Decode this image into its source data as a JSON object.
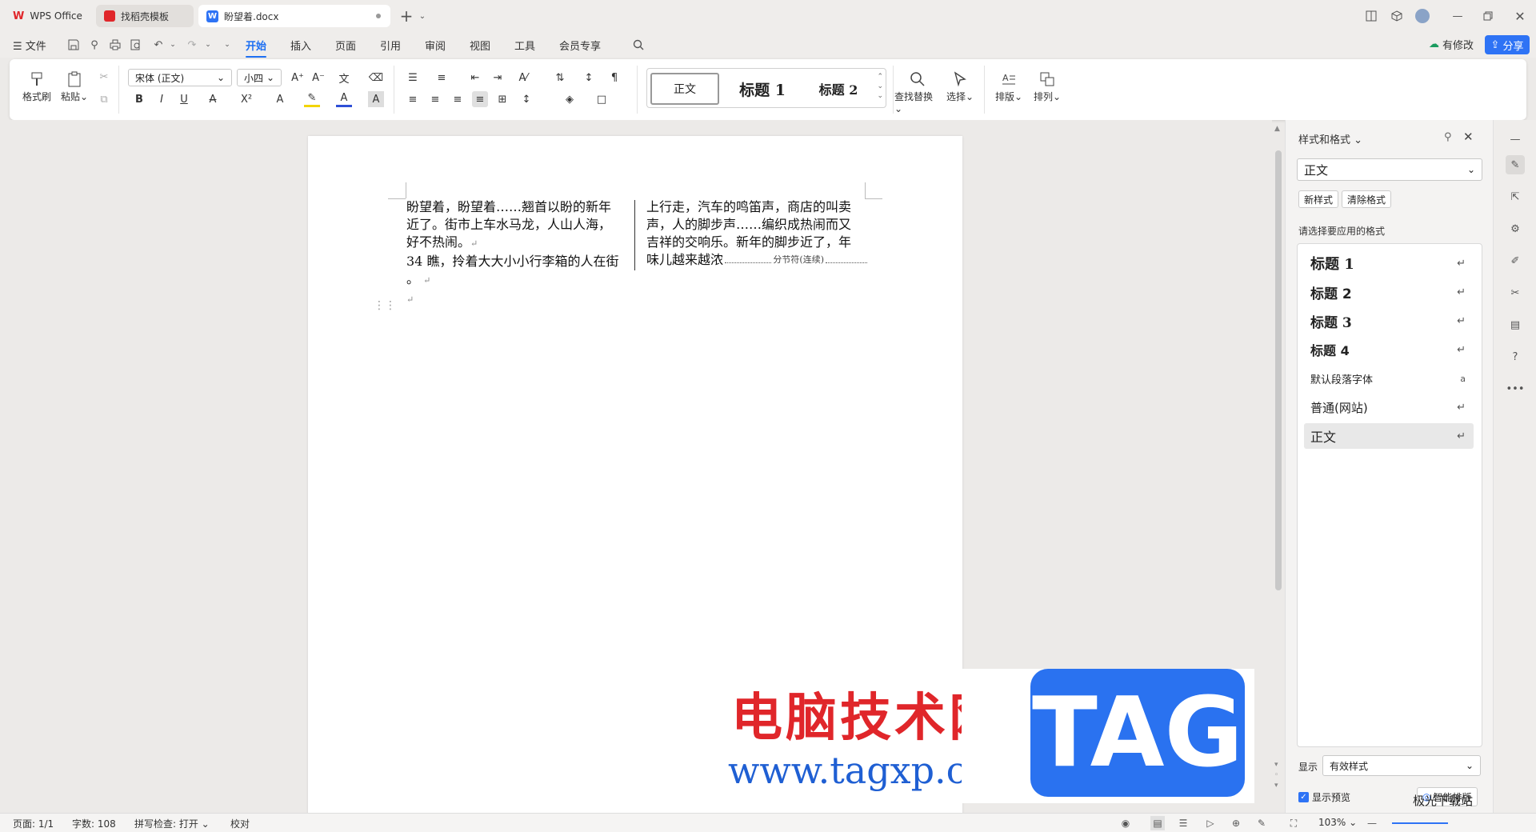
{
  "titlebar": {
    "tabs": [
      {
        "label": "WPS Office"
      },
      {
        "label": "找稻壳模板"
      },
      {
        "label": "盼望着.docx"
      }
    ],
    "new_tab": "+"
  },
  "menu": {
    "file": "文件",
    "items": [
      "开始",
      "插入",
      "页面",
      "引用",
      "审阅",
      "视图",
      "工具",
      "会员专享"
    ],
    "active": "开始",
    "modified": "有修改",
    "share": "分享"
  },
  "ribbon": {
    "format_painter": "格式刷",
    "paste": "粘贴",
    "font_name": "宋体 (正文)",
    "font_size": "小四",
    "styles": [
      "正文",
      "标题 1",
      "标题 2"
    ],
    "find_replace": "查找替换",
    "select": "选择",
    "layout": "排版",
    "arrange": "排列"
  },
  "document": {
    "col1": {
      "line1": "盼望着，盼望着……翘首以盼的新年",
      "line2": "近了。街市上车水马龙，人山人海，",
      "line3": "好不热闹。",
      "line4": "34 瞧，拎着大大小小行李箱的人在街",
      "line5": "。"
    },
    "col2": {
      "line1": "上行走，汽车的鸣笛声，商店的叫卖",
      "line2": "声，人的脚步声……编织成热闹而又",
      "line3": "吉祥的交响乐。新年的脚步近了，年",
      "line4": "味儿越来越浓",
      "section_break": "分节符(连续)"
    },
    "para_mark": "↵"
  },
  "panel": {
    "title": "样式和格式",
    "current_style": "正文",
    "new_style": "新样式",
    "clear_format": "清除格式",
    "prompt": "请选择要应用的格式",
    "styles": [
      {
        "label": "标题  1",
        "mark": "↵"
      },
      {
        "label": "标题  2",
        "mark": "↵"
      },
      {
        "label": "标题  3",
        "mark": "↵"
      },
      {
        "label": "标题 4",
        "mark": "↵"
      },
      {
        "label": "默认段落字体",
        "mark": "a"
      },
      {
        "label": "普通(网站)",
        "mark": "↵"
      },
      {
        "label": "正文",
        "mark": "↵"
      }
    ],
    "show_label": "显示",
    "show_value": "有效样式",
    "preview_label": "显示预览",
    "smart_layout": "智能排版"
  },
  "status": {
    "page": "页面: 1/1",
    "words": "字数: 108",
    "spell": "拼写检查: 打开",
    "proof": "校对",
    "zoom": "103%"
  },
  "watermark": {
    "title": "电脑技术网",
    "url": "www.tagxp.com",
    "tag": "TAG",
    "site": "极光下载站"
  }
}
